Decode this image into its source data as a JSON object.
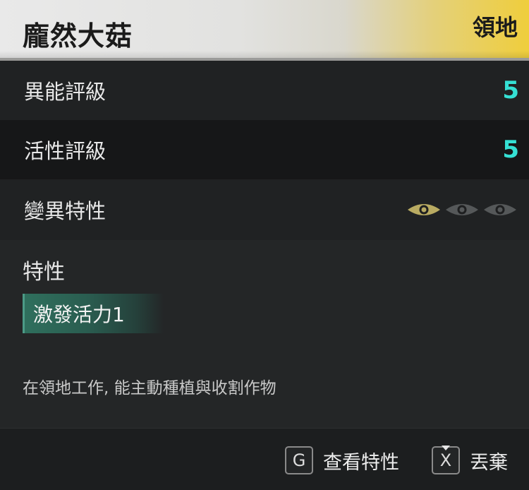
{
  "header": {
    "title": "龐然大菇",
    "territory_label": "領地"
  },
  "stats": [
    {
      "label": "異能評級",
      "value": "5"
    },
    {
      "label": "活性評級",
      "value": "5"
    }
  ],
  "mutation": {
    "label": "變異特性",
    "level": 1,
    "max": 3,
    "active_color": "#b9ab62",
    "inactive_color": "#555859"
  },
  "traits": {
    "heading": "特性",
    "chip": "激發活力1",
    "description": "在領地工作, 能主動種植與收割作物"
  },
  "footer": {
    "actions": [
      {
        "key": "G",
        "label": "查看特性"
      },
      {
        "key": "X",
        "label": "丟棄"
      }
    ]
  }
}
